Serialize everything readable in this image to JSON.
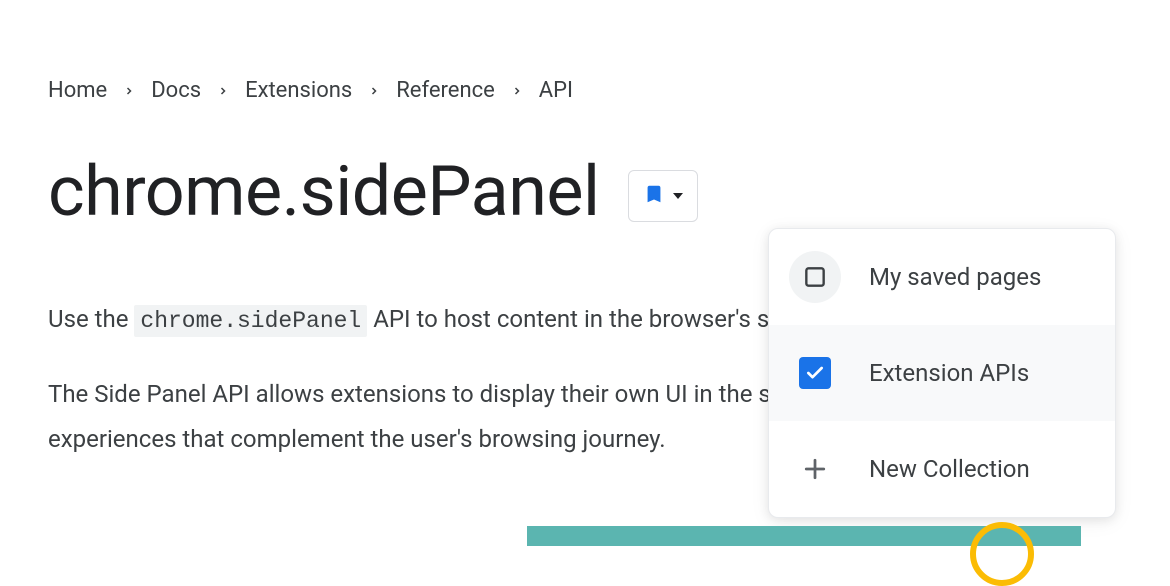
{
  "breadcrumb": {
    "items": [
      "Home",
      "Docs",
      "Extensions",
      "Reference",
      "API"
    ]
  },
  "page": {
    "title": "chrome.sidePanel"
  },
  "body": {
    "intro_pre": "Use the ",
    "intro_code": "chrome.sidePanel",
    "intro_post": " API to host content in the browser's side panel alongside th",
    "para2": "The Side Panel API allows extensions to display their own UI in the side panel, enabling persistent experiences that complement the user's browsing journey."
  },
  "dropdown": {
    "items": [
      {
        "label": "My saved pages"
      },
      {
        "label": "Extension APIs"
      },
      {
        "label": "New Collection"
      }
    ]
  }
}
